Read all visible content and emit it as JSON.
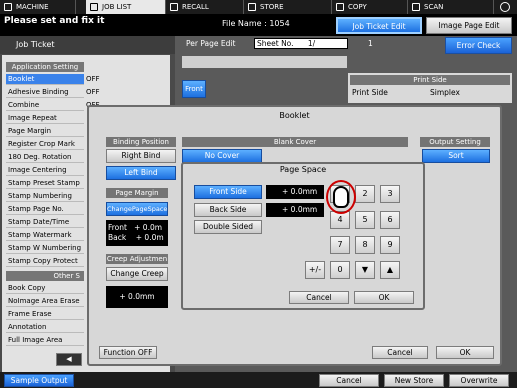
{
  "tabs": [
    {
      "label": "MACHINE",
      "icon": "machine-icon"
    },
    {
      "label": "JOB LIST",
      "icon": "job-list-icon"
    },
    {
      "label": "RECALL",
      "icon": "recall-icon"
    },
    {
      "label": "STORE",
      "icon": "store-icon"
    },
    {
      "label": "COPY",
      "icon": "copy-icon"
    },
    {
      "label": "SCAN",
      "icon": "scan-icon"
    }
  ],
  "alert_text": "Please set and fix it",
  "file_name_text": "File Name : 1054",
  "job_ticket_edit_label": "Job Ticket Edit",
  "image_page_edit_label": "Image Page Edit",
  "left_panel": {
    "header": "Job Ticket",
    "application_setting_title": "Application Setting",
    "items": [
      {
        "label": "Booklet",
        "value": "OFF"
      },
      {
        "label": "Adhesive Binding",
        "value": "OFF"
      },
      {
        "label": "Combine",
        "value": "OFF"
      },
      {
        "label": "Image Repeat",
        "value": ""
      },
      {
        "label": "Page Margin",
        "value": ""
      },
      {
        "label": "Register Crop Mark",
        "value": ""
      },
      {
        "label": "180 Deg. Rotation",
        "value": ""
      },
      {
        "label": "Image Centering",
        "value": ""
      },
      {
        "label": "Stamp Preset Stamp",
        "value": ""
      },
      {
        "label": "Stamp      Numbering",
        "value": ""
      },
      {
        "label": "Stamp       Page No.",
        "value": ""
      },
      {
        "label": "Stamp      Date/Time",
        "value": ""
      },
      {
        "label": "Stamp      Watermark",
        "value": ""
      },
      {
        "label": "Stamp  W Numbering",
        "value": ""
      },
      {
        "label": "Stamp Copy Protect",
        "value": ""
      }
    ],
    "other_settings_title": "Other S",
    "other_items": [
      "Book Copy",
      "NoImage Area Erase",
      "Frame Erase",
      "Annotation",
      "Full Image Area"
    ]
  },
  "per_page_edit": {
    "label": "Per Page Edit",
    "sheet_no_label": "Sheet No.",
    "sheet_no_value": "1/",
    "sheet_no_total": "1",
    "error_check_label": "Error Check",
    "front_label": "Front"
  },
  "print_side": {
    "title": "Print Side",
    "row_label": "Print Side",
    "row_value": "Simplex"
  },
  "booklet_dialog": {
    "title": "Booklet",
    "binding_position_title": "Binding Position",
    "right_bind": "Right Bind",
    "left_bind": "Left Bind",
    "blank_cover_title": "Blank Cover",
    "no_cover": "No Cover",
    "output_setting_title": "Output Setting",
    "sort": "Sort",
    "page_margin_title": "Page Margin",
    "change_page_space": "ChangePageSpace",
    "front_label": "Front",
    "front_value": "+ 0.0m",
    "back_label": "Back",
    "back_value": "+ 0.0m",
    "creep_adjustment_title": "Creep Adjustmen",
    "change_creep": "Change Creep",
    "creep_value": "+ 0.0mm",
    "function_off": "Function OFF",
    "cancel": "Cancel",
    "ok": "OK"
  },
  "page_space_dialog": {
    "title": "Page Space",
    "front_side": "Front Side",
    "back_side": "Back Side",
    "double_sided": "Double Sided",
    "front_value": "+  0.0mm",
    "back_value": "+  0.0mm",
    "keys": [
      "1",
      "2",
      "3",
      "4",
      "5",
      "6",
      "7",
      "8",
      "9",
      "+/-",
      "0",
      "▼",
      "▲"
    ],
    "cancel": "Cancel",
    "ok": "OK"
  },
  "footer": {
    "sample_output": "Sample Output",
    "cancel": "Cancel",
    "new_store": "New Store",
    "overwrite": "Overwrite"
  }
}
